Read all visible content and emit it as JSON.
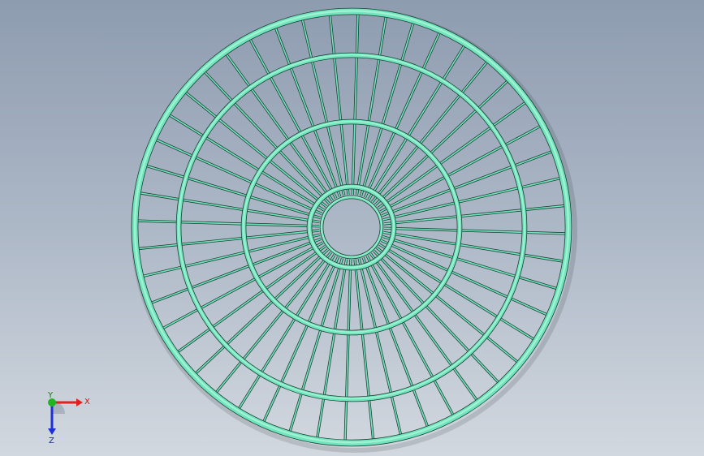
{
  "viewport": {
    "background_top": "#8e9cb0",
    "background_bottom": "#d2d8df"
  },
  "model": {
    "description_colors": {
      "wire": "#6fe6bd",
      "wire_edge": "#1f3d33",
      "wire_highlight": "#b8f5dd"
    },
    "spoke_count": 48,
    "ring_count": 5
  },
  "triad": {
    "x_label": "X",
    "y_label": "Y",
    "z_label": "Z",
    "x_color": "#e32020",
    "y_color": "#22b522",
    "z_color": "#2030d8"
  }
}
